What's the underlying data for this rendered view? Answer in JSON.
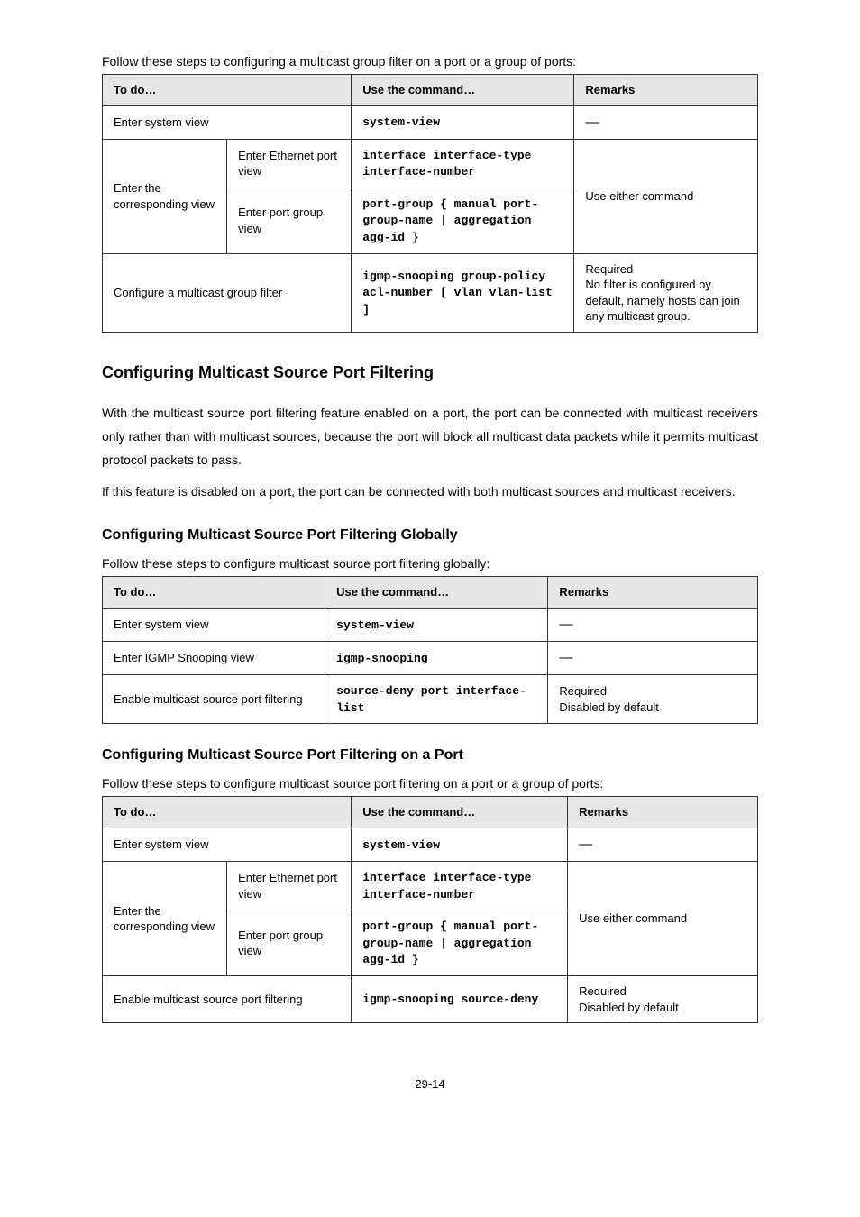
{
  "table1": {
    "intro": "Follow these steps to configuring a multicast group filter on a port or a group of ports:",
    "head": {
      "c1": "To do…",
      "c2": "Use the command…",
      "c3": "Remarks"
    },
    "r1": {
      "c1": "Enter system view",
      "c2": "system-view",
      "c3": "—"
    },
    "r2": {
      "groupLabel": "Enter the corresponding view",
      "a_label": "Enter Ethernet port view",
      "a_cmd": "interface interface-type interface-number",
      "b_label": "Enter port group view",
      "b_cmd": "port-group { manual port-group-name | aggregation agg-id }",
      "remarks": "Use either command"
    },
    "r3": {
      "c1": "Configure a multicast group filter",
      "c2": "igmp-snooping group-policy acl-number [ vlan vlan-list ]",
      "rem_a": "Required",
      "rem_b": "No filter is configured by default, namely hosts can join any multicast group."
    }
  },
  "section": {
    "title": "Configuring Multicast Source Port Filtering",
    "p1": "With the multicast source port filtering feature enabled on a port, the port can be connected with multicast receivers only rather than with multicast sources, because the port will block all multicast data packets while it permits multicast protocol packets to pass.",
    "p2": "If this feature is disabled on a port, the port can be connected with both multicast sources and multicast receivers."
  },
  "table2": {
    "subTitle": "Configuring Multicast Source Port Filtering Globally",
    "intro": "Follow these steps to configure multicast source port filtering globally:",
    "head": {
      "c1": "To do…",
      "c2": "Use the command…",
      "c3": "Remarks"
    },
    "r1": {
      "c1": "Enter system view",
      "c2": "system-view",
      "c3": "—"
    },
    "r2": {
      "c1": "Enter IGMP Snooping view",
      "c2": "igmp-snooping",
      "c3": "—"
    },
    "r3": {
      "c1": "Enable multicast source port filtering",
      "c2": "source-deny port interface-list",
      "rem_a": "Required",
      "rem_b": "Disabled by default"
    }
  },
  "table3": {
    "subTitle": "Configuring Multicast Source Port Filtering on a Port",
    "intro": "Follow these steps to configure multicast source port filtering on a port or a group of ports:",
    "head": {
      "c1": "To do…",
      "c2": "Use the command…",
      "c3": "Remarks"
    },
    "r1": {
      "c1": "Enter system view",
      "c2": "system-view",
      "c3": "—"
    },
    "r2": {
      "groupLabel": "Enter the corresponding view",
      "a_label": "Enter Ethernet port view",
      "a_cmd": "interface interface-type interface-number",
      "b_label": "Enter port group view",
      "b_cmd": "port-group { manual port-group-name | aggregation agg-id }",
      "remarks": "Use either command"
    },
    "r3": {
      "c1": "Enable multicast source port filtering",
      "c2": "igmp-snooping source-deny",
      "rem_a": "Required",
      "rem_b": "Disabled by default"
    }
  },
  "pageNumber": "29-14"
}
